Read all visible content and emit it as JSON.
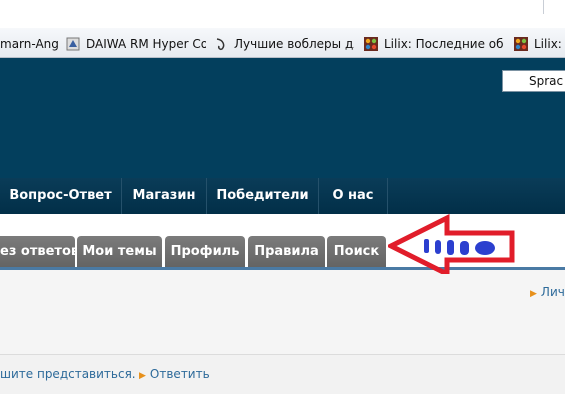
{
  "bookmarks": [
    {
      "label": "marn-Angl",
      "icon": "fish-icon"
    },
    {
      "label": "DAIWA RM Hyper Cor",
      "icon": "bookmark-icon"
    },
    {
      "label": "Лучшие воблеры для",
      "icon": "bookmark-icon"
    },
    {
      "label": "Lilix: Последние обсу",
      "icon": "joomla-icon"
    },
    {
      "label": "Lilix:",
      "icon": "joomla-icon"
    }
  ],
  "header": {
    "search_value": "Sprac"
  },
  "nav": [
    "Вопрос-Ответ",
    "Магазин",
    "Победители",
    "О нас"
  ],
  "tabs": [
    "ез ответов",
    "Мои темы",
    "Профиль",
    "Правила",
    "Поиск"
  ],
  "panel": {
    "link_right": "Личн",
    "footer_text": "шите представиться.",
    "reply_label": "Ответить"
  },
  "colors": {
    "header": "#033f5d",
    "tab": "#6e6e6e",
    "annotation": "#e11d2a",
    "scribble": "#2b3fcf"
  }
}
